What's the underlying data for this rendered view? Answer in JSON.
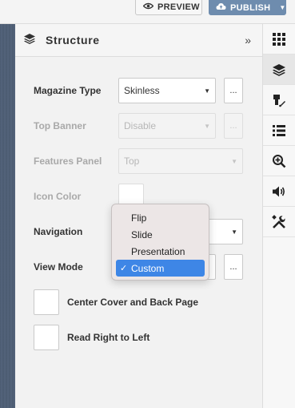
{
  "topbar": {
    "preview_label": "PREVIEW",
    "publish_label": "PUBLISH"
  },
  "panel": {
    "title": "Structure",
    "collapse_glyph": "»"
  },
  "form": {
    "magazine_type": {
      "label": "Magazine Type",
      "value": "Skinless",
      "more": "..."
    },
    "top_banner": {
      "label": "Top Banner",
      "value": "Disable",
      "more": "...",
      "disabled": true
    },
    "features_panel": {
      "label": "Features Panel",
      "value": "Top",
      "disabled": true
    },
    "icon_color": {
      "label": "Icon Color",
      "disabled": true
    },
    "navigation": {
      "label": "Navigation"
    },
    "view_mode": {
      "label": "View Mode",
      "more": "..."
    },
    "center_cover": {
      "label": "Center Cover and Back Page"
    },
    "right_to_left": {
      "label": "Read Right to Left"
    }
  },
  "dropdown": {
    "options": [
      "Flip",
      "Slide",
      "Presentation",
      "Custom"
    ],
    "selected": "Custom",
    "check_glyph": "✓"
  },
  "rail": {
    "icons": [
      "grid-icon",
      "layers-icon",
      "paint-icon",
      "list-icon",
      "zoom-in-icon",
      "volume-icon",
      "tools-icon"
    ],
    "active": "layers-icon"
  },
  "colors": {
    "publish": "#6e8cae",
    "selection": "#3e86e6"
  }
}
